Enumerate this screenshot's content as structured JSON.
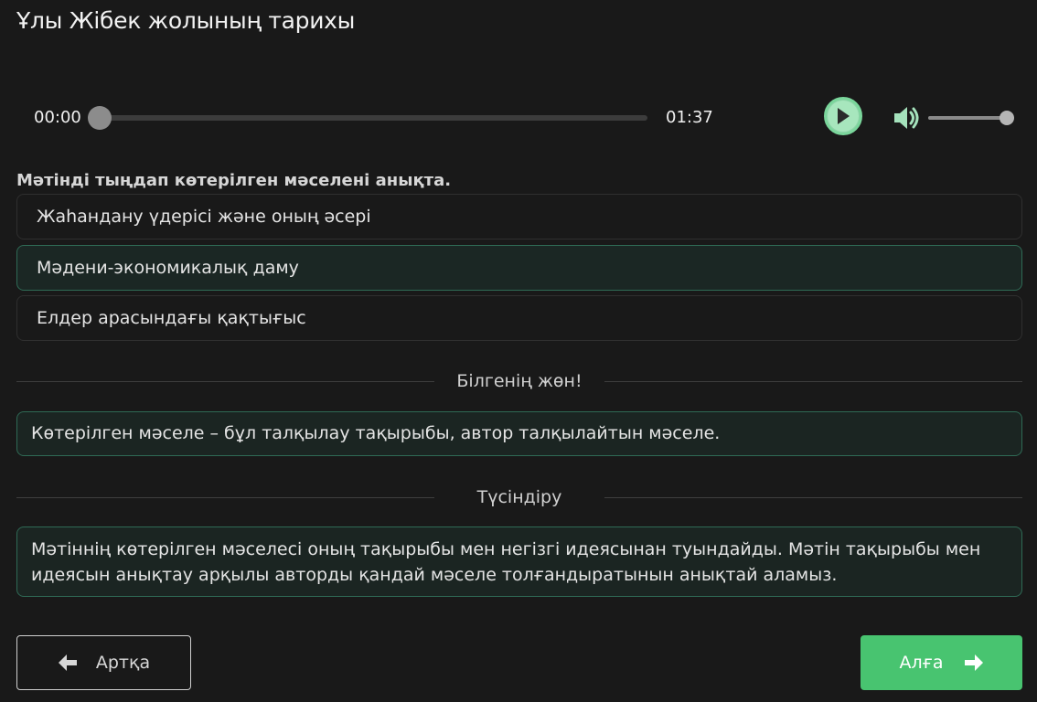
{
  "header": {
    "title": "Ұлы Жібек жолының тарихы"
  },
  "player": {
    "current_time": "00:00",
    "duration": "01:37",
    "progress_fraction": 0.0,
    "volume_fraction": 1.0,
    "play_icon": "play-icon",
    "volume_icon": "volume-icon"
  },
  "question": {
    "prompt": "Мәтінді тыңдап көтерілген мәселені анықта.",
    "options": [
      {
        "label": "Жаһандану үдерісі және оның әсері",
        "selected": false
      },
      {
        "label": "Мәдени-экономикалық даму",
        "selected": true
      },
      {
        "label": "Елдер арасындағы қақтығыс",
        "selected": false
      }
    ]
  },
  "tip": {
    "heading": "Білгенің жөн!",
    "text": "Көтерілген мәселе – бұл талқылау тақырыбы, автор талқылайтын мәселе."
  },
  "explanation": {
    "heading": "Түсіндіру",
    "text": "Мәтіннің көтерілген мәселесі оның тақырыбы мен негізгі идеясынан туындайды. Мәтін тақырыбы мен идеясын анықтау арқылы авторды қандай мәселе толғандыратынын анықтай аламыз."
  },
  "nav": {
    "back_label": "Артқа",
    "next_label": "Алға",
    "back_icon": "arrow-left-icon",
    "next_icon": "arrow-right-icon"
  },
  "colors": {
    "background": "#191919",
    "accent_green": "#48c470",
    "selected_border": "#2f6a55"
  }
}
